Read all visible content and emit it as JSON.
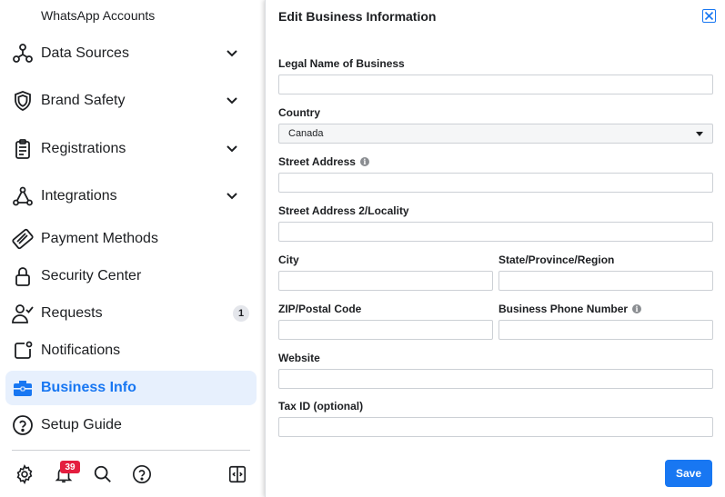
{
  "sidebar": {
    "sub_item": "WhatsApp Accounts",
    "items": [
      {
        "label": "Data Sources",
        "icon": "data-sources-icon",
        "expandable": true
      },
      {
        "label": "Brand Safety",
        "icon": "shield-icon",
        "expandable": true
      },
      {
        "label": "Registrations",
        "icon": "clipboard-icon",
        "expandable": true
      },
      {
        "label": "Integrations",
        "icon": "integrations-icon",
        "expandable": true
      },
      {
        "label": "Payment Methods",
        "icon": "credit-card-icon",
        "expandable": false
      },
      {
        "label": "Security Center",
        "icon": "lock-icon",
        "expandable": false
      },
      {
        "label": "Requests",
        "icon": "person-check-icon",
        "expandable": false,
        "count": "1"
      },
      {
        "label": "Notifications",
        "icon": "notification-icon",
        "expandable": false
      },
      {
        "label": "Business Info",
        "icon": "briefcase-icon",
        "expandable": false,
        "active": true
      },
      {
        "label": "Setup Guide",
        "icon": "question-icon",
        "expandable": false
      }
    ],
    "bottom": {
      "notifications_count": "39",
      "icons": [
        "gear-icon",
        "bell-icon",
        "search-icon",
        "help-icon",
        "panel-toggle-icon"
      ]
    }
  },
  "panel": {
    "title": "Edit Business Information",
    "fields": {
      "legal_name": {
        "label": "Legal Name of Business",
        "value": ""
      },
      "country": {
        "label": "Country",
        "value": "Canada"
      },
      "street": {
        "label": "Street Address",
        "value": ""
      },
      "street2": {
        "label": "Street Address 2/Locality",
        "value": ""
      },
      "city": {
        "label": "City",
        "value": ""
      },
      "state": {
        "label": "State/Province/Region",
        "value": ""
      },
      "zip": {
        "label": "ZIP/Postal Code",
        "value": ""
      },
      "phone": {
        "label": "Business Phone Number",
        "value": ""
      },
      "website": {
        "label": "Website",
        "value": ""
      },
      "tax_id": {
        "label": "Tax ID (optional)",
        "value": ""
      }
    },
    "save_label": "Save"
  },
  "colors": {
    "accent": "#1877f2",
    "active_bg": "#e7f0fd",
    "badge_red": "#e41e3f"
  }
}
